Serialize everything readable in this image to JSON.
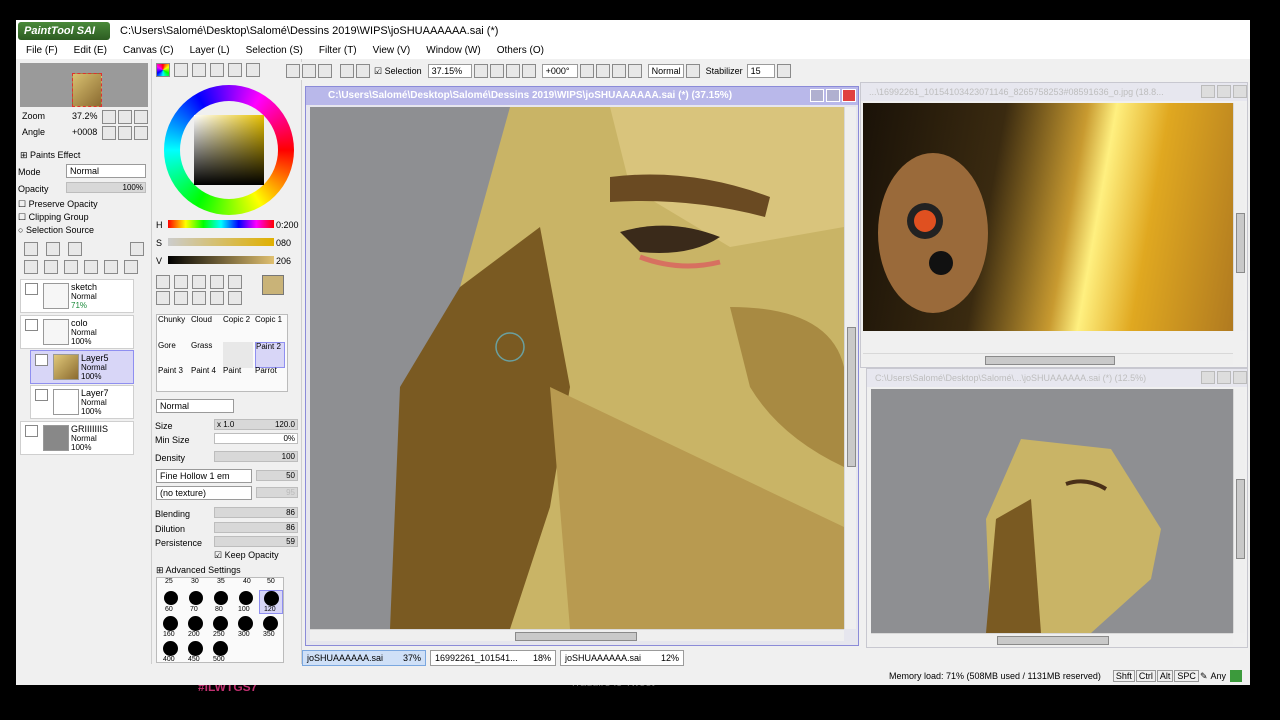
{
  "window": {
    "app_logo": "PaintTool SAI",
    "title": "C:\\Users\\Salomé\\Desktop\\Salomé\\Dessins 2019\\WIPS\\joSHUAAAAAA.sai (*)"
  },
  "menu": [
    "File (F)",
    "Edit (E)",
    "Canvas (C)",
    "Layer (L)",
    "Selection (S)",
    "Filter (T)",
    "View (V)",
    "Window (W)",
    "Others (O)"
  ],
  "navigator": {
    "zoom_label": "Zoom",
    "zoom_value": "37.2%",
    "angle_label": "Angle",
    "angle_value": "+0008"
  },
  "layer_panel": {
    "paints_effect": "Paints Effect",
    "mode_label": "Mode",
    "mode_value": "Normal",
    "opacity_label": "Opacity",
    "opacity_value": "100%",
    "preserve_opacity": "Preserve Opacity",
    "clipping_group": "Clipping Group",
    "selection_source": "Selection Source",
    "layers": [
      {
        "name": "sketch",
        "mode": "Normal",
        "opacity": "71%"
      },
      {
        "name": "colo",
        "mode": "Normal",
        "opacity": "100%"
      },
      {
        "name": "Layer5",
        "mode": "Normal",
        "opacity": "100%"
      },
      {
        "name": "Layer7",
        "mode": "Normal",
        "opacity": "100%"
      },
      {
        "name": "GRIIIIIIIS",
        "mode": "Normal",
        "opacity": "100%"
      }
    ]
  },
  "color": {
    "h_label": "H",
    "h_value": "0:200",
    "s_label": "S",
    "s_value": "080",
    "v_label": "V",
    "v_value": "206",
    "primary": "#c9b378",
    "secondary": "#ffffff"
  },
  "brushes": {
    "row1": [
      "Chunky",
      "Cloud",
      "Copic 2",
      "Copic 1"
    ],
    "row2": [
      "Gore",
      "Grass",
      "",
      "Paint 2"
    ],
    "row3": [
      "Paint 3",
      "Paint 4",
      "Paint",
      "Parrot"
    ],
    "blend_mode": "Normal",
    "size_label": "Size",
    "size_mult": "x 1.0",
    "size_value": "120.0",
    "min_size_label": "Min Size",
    "min_size_value": "0%",
    "density_label": "Density",
    "density_value": "100",
    "shape": "Fine Hollow 1 em",
    "shape_value": "50",
    "texture": "(no texture)",
    "texture_value": "95",
    "blending_label": "Blending",
    "blending_value": "86",
    "dilution_label": "Dilution",
    "dilution_value": "86",
    "persistence_label": "Persistence",
    "persistence_value": "59",
    "keep_opacity": "Keep Opacity",
    "advanced": "Advanced Settings",
    "size_top": [
      "25",
      "30",
      "35",
      "40",
      "50"
    ],
    "sizes": [
      "60",
      "70",
      "80",
      "100",
      "120",
      "160",
      "200",
      "250",
      "300",
      "350",
      "400",
      "450",
      "500"
    ]
  },
  "toolbar": {
    "selection_label": "Selection",
    "zoom": "37.15%",
    "angle": "+000°",
    "mode": "Normal",
    "stabilizer_label": "Stabilizer",
    "stabilizer_value": "15"
  },
  "canvas_window": {
    "title": "C:\\Users\\Salomé\\Desktop\\Salomé\\Dessins 2019\\WIPS\\joSHUAAAAAA.sai (*) (37.15%)"
  },
  "ref_window1": {
    "title": "...\\16992261_10154103423071146_8265758253#08591636_o.jpg (18.8..."
  },
  "ref_window2": {
    "title": "C:\\Users\\Salomé\\Desktop\\Salomé\\...\\joSHUAAAAAA.sai (*) (12.5%)"
  },
  "tabs": [
    {
      "name": "joSHUAAAAAA.sai",
      "zoom": "37%"
    },
    {
      "name": "16992261_101541...",
      "zoom": "18%"
    },
    {
      "name": "joSHUAAAAAA.sai",
      "zoom": "12%"
    }
  ],
  "status": {
    "memory": "Memory load: 71% (508MB used / 1131MB reserved)",
    "keys": [
      "Shft",
      "Ctrl",
      "Alt",
      "SPC"
    ],
    "any": "Any"
  },
  "background_text": {
    "tag": "#ILWTGS7",
    "translate": "Traduire le Tweet"
  }
}
